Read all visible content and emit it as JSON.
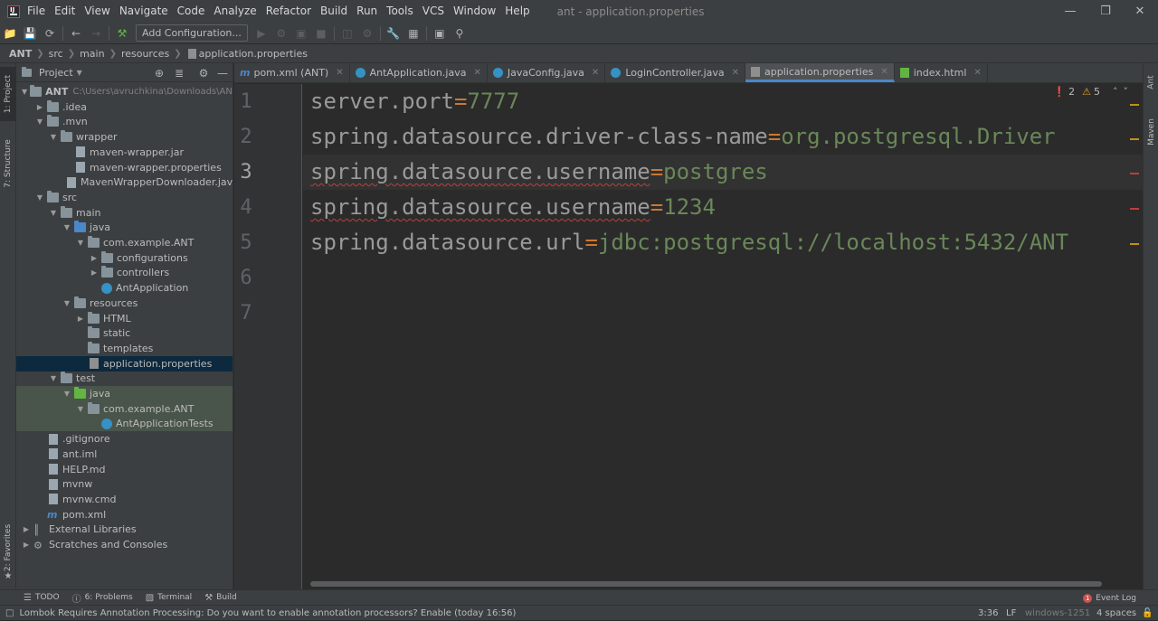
{
  "menu": {
    "items": [
      "File",
      "Edit",
      "View",
      "Navigate",
      "Code",
      "Analyze",
      "Refactor",
      "Build",
      "Run",
      "Tools",
      "VCS",
      "Window",
      "Help"
    ],
    "window_title": "ant - application.properties",
    "logo_text": "IJ"
  },
  "toolbar": {
    "add_config_label": "Add Configuration..."
  },
  "breadcrumb": [
    "ANT",
    "src",
    "main",
    "resources",
    "application.properties"
  ],
  "left_strip": {
    "project_tab": "1: Project",
    "structure_tab": "7: Structure",
    "favorites_tab": "2: Favorites"
  },
  "right_strip": {
    "ant_tab": "Ant",
    "maven_tab": "Maven"
  },
  "project_panel": {
    "title": "Project",
    "tree": [
      {
        "label": "ANT",
        "path": "C:\\Users\\avruchkina\\Downloads\\ANT",
        "indent": 0,
        "arrow": "down",
        "icon": "folder"
      },
      {
        "label": ".idea",
        "indent": 1,
        "arrow": "right",
        "icon": "folder"
      },
      {
        "label": ".mvn",
        "indent": 1,
        "arrow": "down",
        "icon": "folder"
      },
      {
        "label": "wrapper",
        "indent": 2,
        "arrow": "down",
        "icon": "folder"
      },
      {
        "label": "maven-wrapper.jar",
        "indent": 3,
        "arrow": "",
        "icon": "file"
      },
      {
        "label": "maven-wrapper.properties",
        "indent": 3,
        "arrow": "",
        "icon": "file"
      },
      {
        "label": "MavenWrapperDownloader.java",
        "indent": 3,
        "arrow": "",
        "icon": "file"
      },
      {
        "label": "src",
        "indent": 1,
        "arrow": "down",
        "icon": "folder"
      },
      {
        "label": "main",
        "indent": 2,
        "arrow": "down",
        "icon": "folder"
      },
      {
        "label": "java",
        "indent": 3,
        "arrow": "down",
        "icon": "folder-blue"
      },
      {
        "label": "com.example.ANT",
        "indent": 4,
        "arrow": "down",
        "icon": "folder"
      },
      {
        "label": "configurations",
        "indent": 5,
        "arrow": "right",
        "icon": "folder"
      },
      {
        "label": "controllers",
        "indent": 5,
        "arrow": "right",
        "icon": "folder"
      },
      {
        "label": "AntApplication",
        "indent": 5,
        "arrow": "",
        "icon": "class"
      },
      {
        "label": "resources",
        "indent": 3,
        "arrow": "down",
        "icon": "folder-res"
      },
      {
        "label": "HTML",
        "indent": 4,
        "arrow": "right",
        "icon": "folder"
      },
      {
        "label": "static",
        "indent": 4,
        "arrow": "",
        "icon": "folder"
      },
      {
        "label": "templates",
        "indent": 4,
        "arrow": "",
        "icon": "folder"
      },
      {
        "label": "application.properties",
        "indent": 4,
        "arrow": "",
        "icon": "prop",
        "state": "selected"
      },
      {
        "label": "test",
        "indent": 2,
        "arrow": "down",
        "icon": "folder"
      },
      {
        "label": "java",
        "indent": 3,
        "arrow": "down",
        "icon": "folder-green",
        "state": "test"
      },
      {
        "label": "com.example.ANT",
        "indent": 4,
        "arrow": "down",
        "icon": "folder",
        "state": "test"
      },
      {
        "label": "AntApplicationTests",
        "indent": 5,
        "arrow": "",
        "icon": "class",
        "state": "test"
      },
      {
        "label": ".gitignore",
        "indent": 1,
        "arrow": "",
        "icon": "file"
      },
      {
        "label": "ant.iml",
        "indent": 1,
        "arrow": "",
        "icon": "file"
      },
      {
        "label": "HELP.md",
        "indent": 1,
        "arrow": "",
        "icon": "file"
      },
      {
        "label": "mvnw",
        "indent": 1,
        "arrow": "",
        "icon": "file"
      },
      {
        "label": "mvnw.cmd",
        "indent": 1,
        "arrow": "",
        "icon": "file"
      },
      {
        "label": "pom.xml",
        "indent": 1,
        "arrow": "",
        "icon": "maven"
      },
      {
        "label": "External Libraries",
        "indent": 0,
        "arrow": "right",
        "icon": "lib"
      },
      {
        "label": "Scratches and Consoles",
        "indent": 0,
        "arrow": "right",
        "icon": "scratch"
      }
    ]
  },
  "tabs": [
    {
      "label": "pom.xml (ANT)",
      "icon": "maven",
      "active": false
    },
    {
      "label": "AntApplication.java",
      "icon": "class",
      "active": false
    },
    {
      "label": "JavaConfig.java",
      "icon": "class",
      "active": false
    },
    {
      "label": "LoginController.java",
      "icon": "class",
      "active": false
    },
    {
      "label": "application.properties",
      "icon": "prop",
      "active": true
    },
    {
      "label": "index.html",
      "icon": "html",
      "active": false
    }
  ],
  "editor": {
    "lines": [
      {
        "num": "1",
        "key": "server.port",
        "value": "7777",
        "error": false
      },
      {
        "num": "2",
        "key": "spring.datasource.driver-class-name",
        "value": "org.postgresql.Driver",
        "error": false
      },
      {
        "num": "3",
        "key": "spring.datasource.username",
        "value": "postgres",
        "error": true
      },
      {
        "num": "4",
        "key": "spring.datasource.username",
        "value": "1234",
        "error": true
      },
      {
        "num": "5",
        "key": "spring.datasource.url",
        "value": "jdbc:postgresql://localhost:5432/ANT",
        "error": false
      },
      {
        "num": "6",
        "key": "",
        "value": "",
        "error": false
      },
      {
        "num": "7",
        "key": "",
        "value": "",
        "error": false
      }
    ],
    "current_line": 3,
    "inspection": {
      "errors": "2",
      "warnings": "5"
    }
  },
  "bottom_tools": {
    "todo": "TODO",
    "problems": "6: Problems",
    "terminal": "Terminal",
    "build": "Build",
    "event_log": "Event Log",
    "event_count": "1"
  },
  "status": {
    "message": "Lombok Requires Annotation Processing: Do you want to enable annotation processors? Enable (today 16:56)",
    "position": "3:36",
    "line_sep": "LF",
    "encoding": "windows-1251",
    "indent": "4 spaces"
  },
  "colors": {
    "key": "#9a9a9a",
    "equals": "#cc7832",
    "value": "#6a8759",
    "error": "#bc3f3c",
    "warning": "#be9117",
    "selection": "#0d293e"
  }
}
